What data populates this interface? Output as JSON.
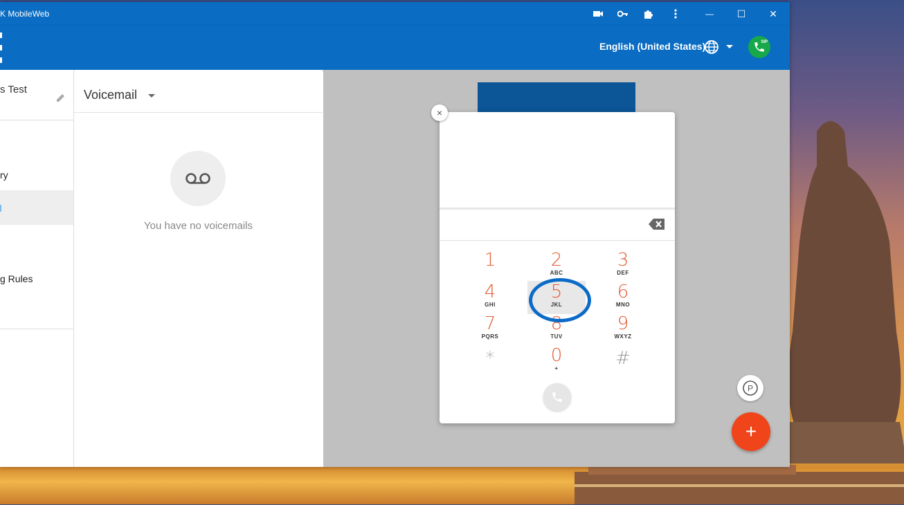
{
  "window": {
    "title": "K MobileWeb"
  },
  "titlebar_icons": [
    "video-icon",
    "key-icon",
    "puzzle-icon",
    "more-vert-icon"
  ],
  "window_controls": {
    "minimize": "—",
    "maximize": "☐",
    "close": "✕"
  },
  "appbar": {
    "language": "English (United States)",
    "sip_label": "SIP"
  },
  "nav": {
    "user": "s Test",
    "items": [
      {
        "label": "ry"
      },
      {
        "label": ""
      },
      {
        "label": "g Rules"
      }
    ]
  },
  "voicemail": {
    "header": "Voicemail",
    "empty_message": "You have no voicemails"
  },
  "dialpad": {
    "close": "×",
    "keys": [
      {
        "digit": "1",
        "letters": ""
      },
      {
        "digit": "2",
        "letters": "ABC"
      },
      {
        "digit": "3",
        "letters": "DEF"
      },
      {
        "digit": "4",
        "letters": "GHI"
      },
      {
        "digit": "5",
        "letters": "JKL"
      },
      {
        "digit": "6",
        "letters": "MNO"
      },
      {
        "digit": "7",
        "letters": "PQRS"
      },
      {
        "digit": "8",
        "letters": "TUV"
      },
      {
        "digit": "9",
        "letters": "WXYZ"
      },
      {
        "digit": "*",
        "letters": ""
      },
      {
        "digit": "0",
        "letters": "+"
      },
      {
        "digit": "#",
        "letters": ""
      }
    ],
    "highlighted_key": "5"
  },
  "fab": {
    "add": "+",
    "park": "P"
  },
  "colors": {
    "brand": "#0a6cc2",
    "digit": "#e25b33",
    "fab": "#f0441b",
    "sip": "#17a84a"
  }
}
